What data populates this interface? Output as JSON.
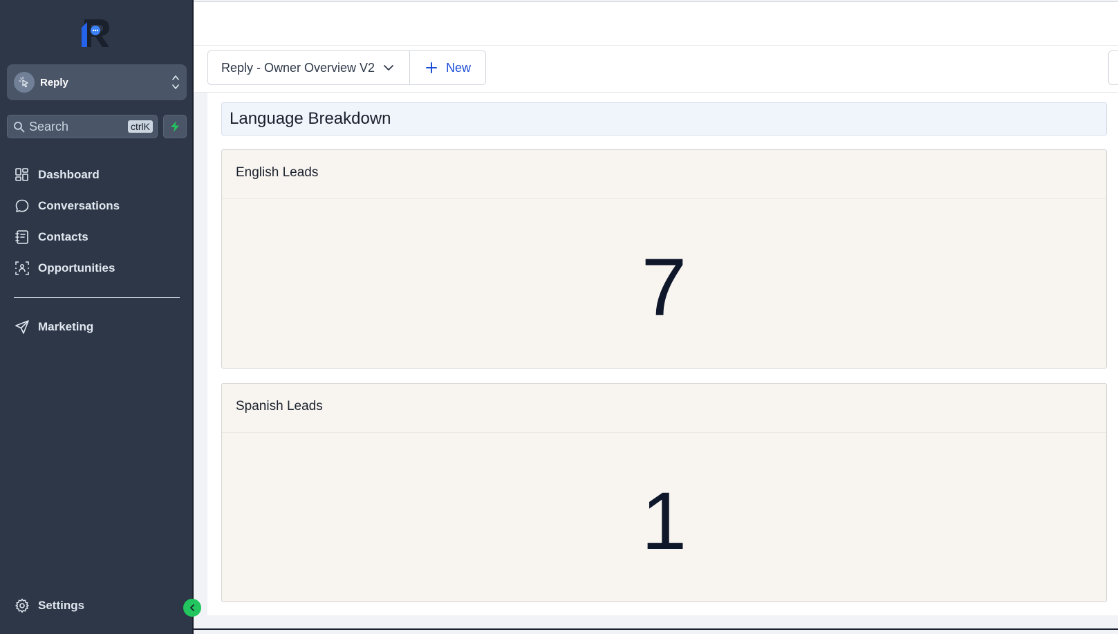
{
  "sidebar": {
    "account": {
      "name": "Reply"
    },
    "search": {
      "placeholder": "Search",
      "shortcut": "ctrlK"
    },
    "nav": [
      {
        "label": "Dashboard",
        "icon": "dashboard-icon"
      },
      {
        "label": "Conversations",
        "icon": "chat-bubble-icon"
      },
      {
        "label": "Contacts",
        "icon": "contacts-book-icon"
      },
      {
        "label": "Opportunities",
        "icon": "opportunities-icon"
      },
      {
        "label": "Marketing",
        "icon": "send-icon"
      }
    ],
    "settings": {
      "label": "Settings",
      "icon": "gear-icon"
    }
  },
  "toolbar": {
    "dashboard_name": "Reply - Owner Overview V2",
    "new_label": "New"
  },
  "section": {
    "title": "Language Breakdown"
  },
  "cards": [
    {
      "title": "English Leads",
      "value": "7"
    },
    {
      "title": "Spanish Leads",
      "value": "1"
    }
  ],
  "colors": {
    "sidebar_bg": "#2d3748",
    "accent_green": "#22c55e",
    "link_blue": "#1d4ed8",
    "card_bg": "#f8f5f1"
  }
}
